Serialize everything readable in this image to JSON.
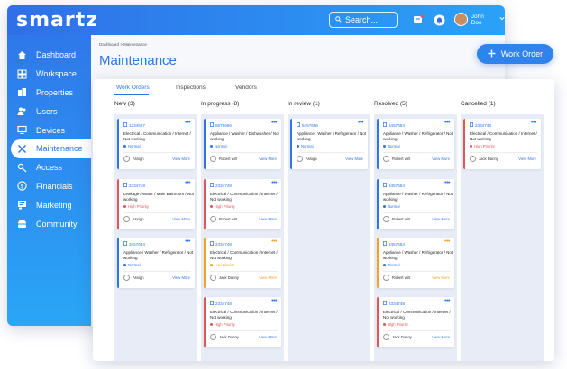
{
  "app": {
    "logo": "smartz"
  },
  "topbar": {
    "search_placeholder": "Search...",
    "user_name": "John Doe"
  },
  "sidebar": {
    "items": [
      {
        "label": "Dashboard",
        "icon": "home-icon",
        "active": false
      },
      {
        "label": "Workspace",
        "icon": "grid-icon",
        "active": false
      },
      {
        "label": "Properties",
        "icon": "building-icon",
        "active": false
      },
      {
        "label": "Users",
        "icon": "users-icon",
        "active": false
      },
      {
        "label": "Devices",
        "icon": "monitor-icon",
        "active": false
      },
      {
        "label": "Maintenance",
        "icon": "tools-icon",
        "active": true
      },
      {
        "label": "Access",
        "icon": "key-icon",
        "active": false
      },
      {
        "label": "Financials",
        "icon": "dollar-icon",
        "active": false
      },
      {
        "label": "Marketing",
        "icon": "megaphone-icon",
        "active": false
      },
      {
        "label": "Community",
        "icon": "community-icon",
        "active": false
      }
    ]
  },
  "main": {
    "breadcrumb": "Dashboard  >  Maintenance",
    "title": "Maintenance",
    "work_order_button": "Work Order"
  },
  "board": {
    "tabs": [
      "Work Orders",
      "Inspections",
      "Vendors"
    ],
    "columns": [
      {
        "title": "New (3)",
        "cards": [
          {
            "id": "1234567",
            "desc": "Electrical / Communication / Internet / Not working",
            "priority": "Normal",
            "assignee": "Assign",
            "view": "View More",
            "color": "blue"
          },
          {
            "id": "2334748",
            "desc": "Leakage / Water / Main Bathroom / Not working",
            "priority": "High Priority",
            "assignee": "Assign",
            "view": "View More",
            "color": "red"
          },
          {
            "id": "3457654",
            "desc": "Appliance / Washer / Refrigerator / Not working",
            "priority": "Normal",
            "assignee": "Assign",
            "view": "View More",
            "color": "blue"
          }
        ]
      },
      {
        "title": "In progress (8)",
        "cards": [
          {
            "id": "5678656",
            "desc": "Appliance / Washer / Dishwasher / Not working",
            "priority": "Normal",
            "assignee": "Robert wirt",
            "view": "View More",
            "color": "blue"
          },
          {
            "id": "2334748",
            "desc": "Electrical / Communication / Internet / Not working",
            "priority": "High Priority",
            "assignee": "Robert wirt",
            "view": "View More",
            "color": "red"
          },
          {
            "id": "2334748",
            "desc": "Electrical / Communication / Internet / Not working",
            "priority": "Low Priority",
            "assignee": "Jack Danny",
            "view": "View More",
            "color": "orange"
          },
          {
            "id": "2334748",
            "desc": "Electrical / Communication / Internet / Not working",
            "priority": "High Priority",
            "assignee": "Jack Danny",
            "view": "View More",
            "color": "red"
          }
        ]
      },
      {
        "title": "In review (1)",
        "cards": [
          {
            "id": "5467654",
            "desc": "Appliance / Washer / Refrigerator / Not working",
            "priority": "Normal",
            "assignee": "Assign",
            "view": "View More",
            "color": "blue"
          }
        ]
      },
      {
        "title": "Resolved (5)",
        "cards": [
          {
            "id": "3457654",
            "desc": "Appliance / Washer / Refrigerator / Not working",
            "priority": "Normal",
            "assignee": "Robert wirt",
            "view": "View More",
            "color": "blue"
          },
          {
            "id": "3457654",
            "desc": "Appliance / Washer / Refrigerator / Not working",
            "priority": "Normal",
            "assignee": "Robert wirt",
            "view": "View More",
            "color": "blue"
          },
          {
            "id": "3457654",
            "desc": "Appliance / Washer / Refrigerator / Not working",
            "priority": "Normal",
            "assignee": "Robert wirt",
            "view": "View More",
            "color": "orange"
          },
          {
            "id": "2334748",
            "desc": "Electrical / Communication / Internet / Not working",
            "priority": "High Priority",
            "assignee": "Jack Danny",
            "view": "View More",
            "color": "red"
          }
        ]
      },
      {
        "title": "Cancelled (1)",
        "cards": [
          {
            "id": "2334748",
            "desc": "Electrical / Communication / Internet / Not working",
            "priority": "High Priority",
            "assignee": "Jack Danny",
            "view": "View More",
            "color": "red"
          }
        ]
      }
    ]
  },
  "colors": {
    "accent": "#2f75e8",
    "high": "#e0565b",
    "low": "#f2a22b",
    "normal": "#2f75e8"
  }
}
